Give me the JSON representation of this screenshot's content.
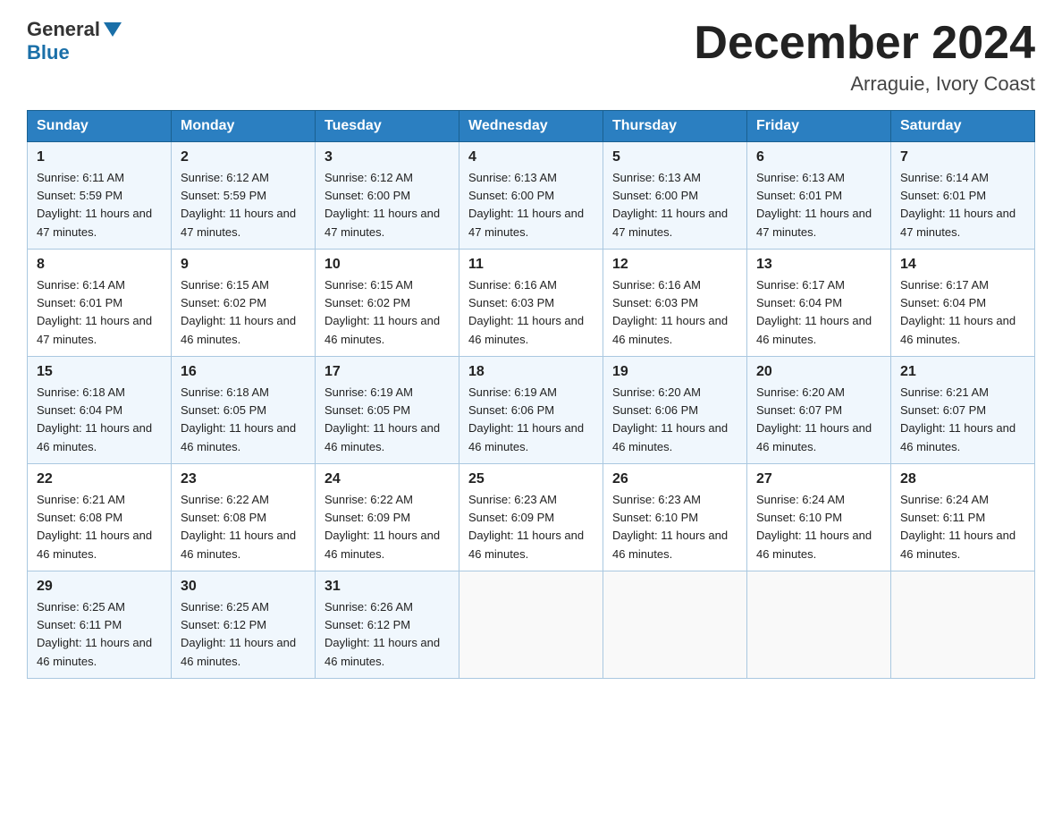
{
  "header": {
    "logo": {
      "general": "General",
      "blue": "Blue"
    },
    "title": "December 2024",
    "location": "Arraguie, Ivory Coast"
  },
  "days_of_week": [
    "Sunday",
    "Monday",
    "Tuesday",
    "Wednesday",
    "Thursday",
    "Friday",
    "Saturday"
  ],
  "weeks": [
    [
      {
        "day": "1",
        "sunrise": "6:11 AM",
        "sunset": "5:59 PM",
        "daylight": "11 hours and 47 minutes."
      },
      {
        "day": "2",
        "sunrise": "6:12 AM",
        "sunset": "5:59 PM",
        "daylight": "11 hours and 47 minutes."
      },
      {
        "day": "3",
        "sunrise": "6:12 AM",
        "sunset": "6:00 PM",
        "daylight": "11 hours and 47 minutes."
      },
      {
        "day": "4",
        "sunrise": "6:13 AM",
        "sunset": "6:00 PM",
        "daylight": "11 hours and 47 minutes."
      },
      {
        "day": "5",
        "sunrise": "6:13 AM",
        "sunset": "6:00 PM",
        "daylight": "11 hours and 47 minutes."
      },
      {
        "day": "6",
        "sunrise": "6:13 AM",
        "sunset": "6:01 PM",
        "daylight": "11 hours and 47 minutes."
      },
      {
        "day": "7",
        "sunrise": "6:14 AM",
        "sunset": "6:01 PM",
        "daylight": "11 hours and 47 minutes."
      }
    ],
    [
      {
        "day": "8",
        "sunrise": "6:14 AM",
        "sunset": "6:01 PM",
        "daylight": "11 hours and 47 minutes."
      },
      {
        "day": "9",
        "sunrise": "6:15 AM",
        "sunset": "6:02 PM",
        "daylight": "11 hours and 46 minutes."
      },
      {
        "day": "10",
        "sunrise": "6:15 AM",
        "sunset": "6:02 PM",
        "daylight": "11 hours and 46 minutes."
      },
      {
        "day": "11",
        "sunrise": "6:16 AM",
        "sunset": "6:03 PM",
        "daylight": "11 hours and 46 minutes."
      },
      {
        "day": "12",
        "sunrise": "6:16 AM",
        "sunset": "6:03 PM",
        "daylight": "11 hours and 46 minutes."
      },
      {
        "day": "13",
        "sunrise": "6:17 AM",
        "sunset": "6:04 PM",
        "daylight": "11 hours and 46 minutes."
      },
      {
        "day": "14",
        "sunrise": "6:17 AM",
        "sunset": "6:04 PM",
        "daylight": "11 hours and 46 minutes."
      }
    ],
    [
      {
        "day": "15",
        "sunrise": "6:18 AM",
        "sunset": "6:04 PM",
        "daylight": "11 hours and 46 minutes."
      },
      {
        "day": "16",
        "sunrise": "6:18 AM",
        "sunset": "6:05 PM",
        "daylight": "11 hours and 46 minutes."
      },
      {
        "day": "17",
        "sunrise": "6:19 AM",
        "sunset": "6:05 PM",
        "daylight": "11 hours and 46 minutes."
      },
      {
        "day": "18",
        "sunrise": "6:19 AM",
        "sunset": "6:06 PM",
        "daylight": "11 hours and 46 minutes."
      },
      {
        "day": "19",
        "sunrise": "6:20 AM",
        "sunset": "6:06 PM",
        "daylight": "11 hours and 46 minutes."
      },
      {
        "day": "20",
        "sunrise": "6:20 AM",
        "sunset": "6:07 PM",
        "daylight": "11 hours and 46 minutes."
      },
      {
        "day": "21",
        "sunrise": "6:21 AM",
        "sunset": "6:07 PM",
        "daylight": "11 hours and 46 minutes."
      }
    ],
    [
      {
        "day": "22",
        "sunrise": "6:21 AM",
        "sunset": "6:08 PM",
        "daylight": "11 hours and 46 minutes."
      },
      {
        "day": "23",
        "sunrise": "6:22 AM",
        "sunset": "6:08 PM",
        "daylight": "11 hours and 46 minutes."
      },
      {
        "day": "24",
        "sunrise": "6:22 AM",
        "sunset": "6:09 PM",
        "daylight": "11 hours and 46 minutes."
      },
      {
        "day": "25",
        "sunrise": "6:23 AM",
        "sunset": "6:09 PM",
        "daylight": "11 hours and 46 minutes."
      },
      {
        "day": "26",
        "sunrise": "6:23 AM",
        "sunset": "6:10 PM",
        "daylight": "11 hours and 46 minutes."
      },
      {
        "day": "27",
        "sunrise": "6:24 AM",
        "sunset": "6:10 PM",
        "daylight": "11 hours and 46 minutes."
      },
      {
        "day": "28",
        "sunrise": "6:24 AM",
        "sunset": "6:11 PM",
        "daylight": "11 hours and 46 minutes."
      }
    ],
    [
      {
        "day": "29",
        "sunrise": "6:25 AM",
        "sunset": "6:11 PM",
        "daylight": "11 hours and 46 minutes."
      },
      {
        "day": "30",
        "sunrise": "6:25 AM",
        "sunset": "6:12 PM",
        "daylight": "11 hours and 46 minutes."
      },
      {
        "day": "31",
        "sunrise": "6:26 AM",
        "sunset": "6:12 PM",
        "daylight": "11 hours and 46 minutes."
      },
      null,
      null,
      null,
      null
    ]
  ]
}
